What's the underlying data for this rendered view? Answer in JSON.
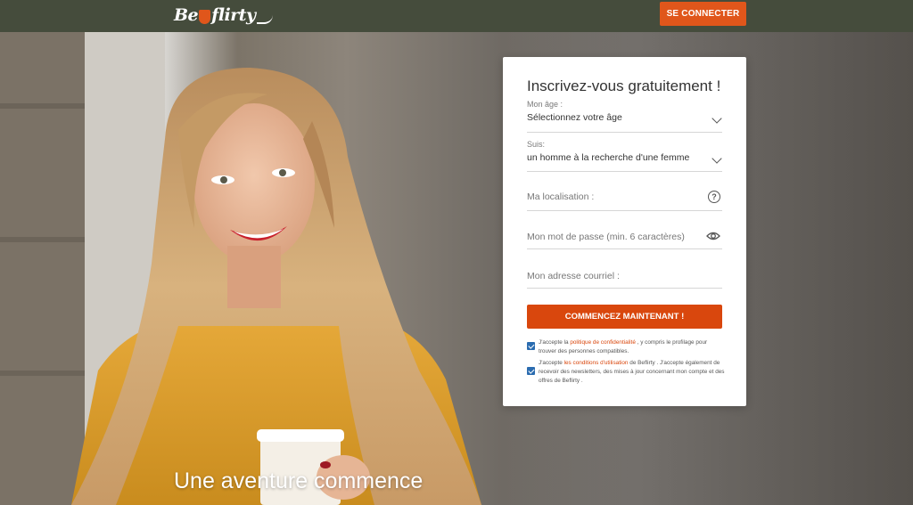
{
  "header": {
    "logo_text_left": "Be",
    "logo_text_right": "flirty",
    "login_label": "SE CONNECTER"
  },
  "hero": {
    "slogan": "Une aventure commence"
  },
  "form": {
    "title": "Inscrivez-vous gratuitement !",
    "age": {
      "label": "Mon âge :",
      "value": "Sélectionnez votre âge"
    },
    "seeking": {
      "label": "Suis:",
      "value": "un homme à la recherche d'une femme"
    },
    "location": {
      "placeholder": "Ma localisation :"
    },
    "password": {
      "placeholder": "Mon mot de passe (min. 6 caractères)"
    },
    "email": {
      "placeholder": "Mon adresse courriel :"
    },
    "submit_label": "COMMENCEZ MAINTENANT !",
    "consent_privacy": {
      "before": "J'accepte la ",
      "link": "politique de confidentialité",
      "after": " , y compris le profilage pour trouver des personnes compatibles."
    },
    "consent_terms": {
      "before": "J'accepte ",
      "link": "les conditions d'utilisation",
      "after": " de Beflirty . J'accepte également de recevoir des newsletters, des mises à jour concernant mon compte et des offres de Beflirty ."
    }
  },
  "colors": {
    "topbar": "#454c3c",
    "accent": "#e0561b",
    "cta": "#d9470d",
    "checkbox": "#2b6cb0"
  }
}
